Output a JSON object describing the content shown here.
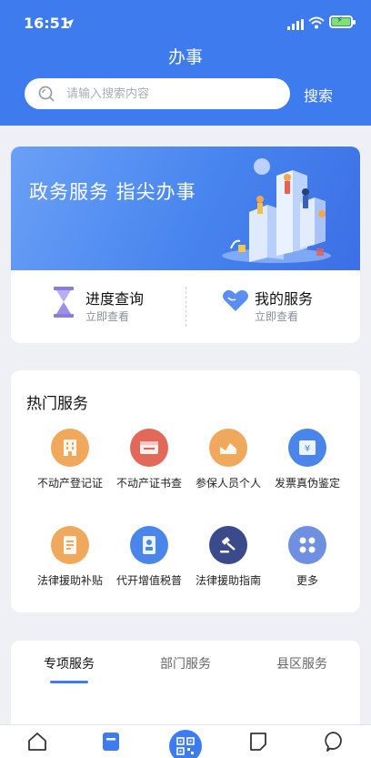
{
  "status_bar": {
    "time": "16:51"
  },
  "header": {
    "title": "办事",
    "search_placeholder": "请输入搜索内容",
    "search_button": "搜索",
    "accent": "#3e7bef"
  },
  "banner": {
    "text": "政务服务  指尖办事"
  },
  "quick_links": [
    {
      "title": "进度查询",
      "sub": "立即查看",
      "icon": "hourglass-icon"
    },
    {
      "title": "我的服务",
      "sub": "立即查看",
      "icon": "heart-icon"
    }
  ],
  "hot_services": {
    "title": "热门服务",
    "items": [
      {
        "label": "不动产登记证",
        "icon": "building-icon",
        "color": "#f0a95c"
      },
      {
        "label": "不动产证书查",
        "icon": "certificate-icon",
        "color": "#e2685a"
      },
      {
        "label": "参保人员个人",
        "icon": "chart-icon",
        "color": "#f0a95c"
      },
      {
        "label": "发票真伪鉴定",
        "icon": "ticket-icon",
        "color": "#4a86ea"
      },
      {
        "label": "法律援助补贴",
        "icon": "document-icon",
        "color": "#f0a95c"
      },
      {
        "label": "代开增值税普",
        "icon": "id-card-icon",
        "color": "#4a86ea"
      },
      {
        "label": "法律援助指南",
        "icon": "gavel-icon",
        "color": "#3a4a8a"
      },
      {
        "label": "更多",
        "icon": "more-grid-icon",
        "color": "#6f8fe0"
      }
    ]
  },
  "tabs": {
    "items": [
      "专项服务",
      "部门服务",
      "县区服务"
    ],
    "active": "专项服务"
  },
  "bottom_nav": [
    "home-icon",
    "service-icon",
    "scan-icon",
    "notes-icon",
    "profile-icon"
  ]
}
